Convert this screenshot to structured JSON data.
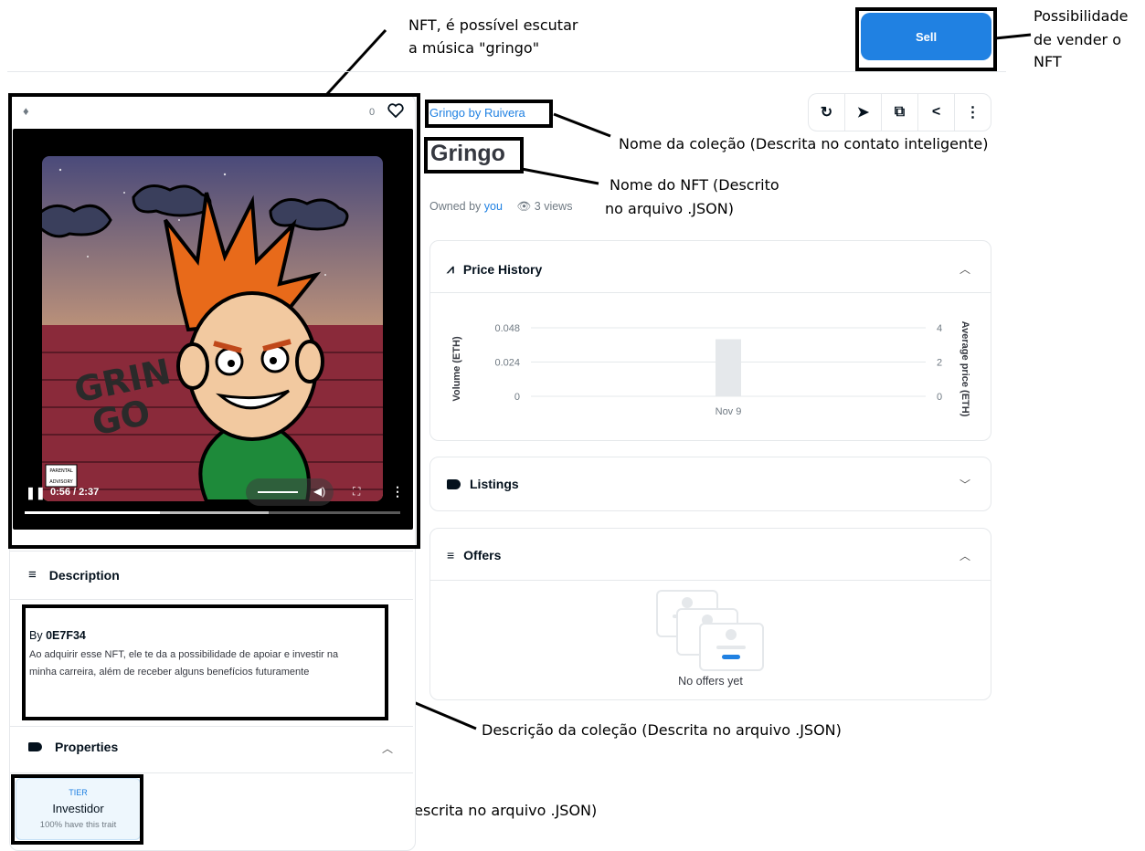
{
  "annotations": {
    "nft_player": {
      "line1": "NFT, é possível escutar",
      "line2": "a música \"gringo\""
    },
    "sell": {
      "line1": "Possibilidade",
      "line2": "de vender o",
      "line3": "NFT"
    },
    "collection_name": "Nome da coleção (Descrita no contato inteligente)",
    "nft_name": {
      "line1": "Nome do NFT (Descrito",
      "line2": "no arquivo .JSON)"
    },
    "description": "Descrição da coleção (Descrita no arquivo .JSON)",
    "properties": "Propriedades do NFT (Descrita no arquivo .JSON)"
  },
  "header": {
    "sell_label": "Sell"
  },
  "asset": {
    "chain_icon": "ethereum-icon",
    "like_count": "0",
    "collection": "Gringo by Ruivera",
    "title": "Gringo",
    "owned_by_prefix": "Owned by",
    "owner": "you",
    "views": "3 views"
  },
  "art": {
    "graffiti_line1": "GRIN",
    "graffiti_line2": "GO",
    "parental_line1": "PARENTAL",
    "parental_line2": "ADVISORY"
  },
  "player": {
    "time": "0:56 / 2:37",
    "progress": 0.36,
    "buffered": 0.65
  },
  "toolbar": {
    "icons": [
      "refresh-icon",
      "transfer-icon",
      "open-external-icon",
      "share-icon",
      "more-icon"
    ]
  },
  "description": {
    "title": "Description",
    "by_prefix": "By",
    "creator": "0E7F34",
    "text": "Ao adquirir esse NFT, ele te da a possibilidade de apoiar e investir na minha carreira, além de receber alguns benefícios futuramente"
  },
  "properties": {
    "title": "Properties",
    "items": [
      {
        "type": "TIER",
        "value": "Investidor",
        "rarity": "100% have this trait"
      }
    ]
  },
  "price_history": {
    "title": "Price History"
  },
  "listings": {
    "title": "Listings"
  },
  "offers": {
    "title": "Offers",
    "empty_text": "No offers yet"
  },
  "chart_data": {
    "type": "bar",
    "categories": [
      "Nov 9"
    ],
    "values": [
      0.04
    ],
    "ylabel": "Volume (ETH)",
    "y2label": "Average price (ETH)",
    "ylim": [
      0,
      0.048
    ],
    "y2lim": [
      0,
      4
    ],
    "yticks": [
      "0.048",
      "0.024",
      "0"
    ],
    "y2ticks": [
      "4",
      "2",
      "0"
    ]
  },
  "colors": {
    "accent": "#2081e2",
    "box": "#000000"
  }
}
